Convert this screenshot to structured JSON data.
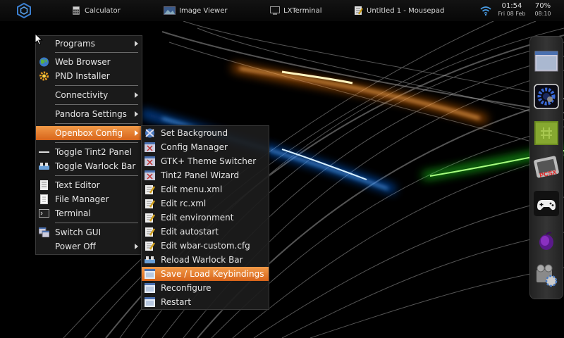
{
  "taskbar": {
    "tasks": [
      {
        "label": "Calculator",
        "icon": "calculator-icon"
      },
      {
        "label": "Image Viewer",
        "icon": "image-viewer-icon"
      },
      {
        "label": "LXTerminal",
        "icon": "terminal-icon"
      },
      {
        "label": "Untitled 1 - Mousepad",
        "icon": "text-editor-icon"
      }
    ],
    "clock_time": "01:54",
    "clock_date": "Fri 08 Feb",
    "battery_percent": "70%",
    "battery_time": "08:10"
  },
  "main_menu": {
    "items": [
      {
        "label": "Programs",
        "icon": "",
        "submenu": true
      },
      {
        "label": "Web Browser",
        "icon": "globe-icon",
        "submenu": false
      },
      {
        "label": "PND Installer",
        "icon": "gear-icon",
        "submenu": false
      },
      {
        "label": "Connectivity",
        "icon": "",
        "submenu": true
      },
      {
        "label": "Pandora Settings",
        "icon": "",
        "submenu": true
      },
      {
        "label": "Openbox Config",
        "icon": "",
        "submenu": true,
        "active": true
      },
      {
        "label": "Toggle Tint2 Panel",
        "icon": "panel-icon",
        "submenu": false
      },
      {
        "label": "Toggle Warlock Bar",
        "icon": "dock-bar-icon",
        "submenu": false
      },
      {
        "label": "Text Editor",
        "icon": "notepad-icon",
        "submenu": false
      },
      {
        "label": "File Manager",
        "icon": "file-manager-icon",
        "submenu": false
      },
      {
        "label": "Terminal",
        "icon": "terminal-icon",
        "submenu": false
      },
      {
        "label": "Switch GUI",
        "icon": "switch-gui-icon",
        "submenu": false
      },
      {
        "label": "Power Off",
        "icon": "",
        "submenu": true
      }
    ]
  },
  "sub_menu": {
    "items": [
      {
        "label": "Set Background",
        "icon": "background-icon"
      },
      {
        "label": "Config Manager",
        "icon": "config-icon"
      },
      {
        "label": "GTK+ Theme Switcher",
        "icon": "config-icon"
      },
      {
        "label": "Tint2 Panel Wizard",
        "icon": "config-icon"
      },
      {
        "label": "Edit menu.xml",
        "icon": "edit-file-icon"
      },
      {
        "label": "Edit rc.xml",
        "icon": "edit-file-icon"
      },
      {
        "label": "Edit environment",
        "icon": "edit-file-icon"
      },
      {
        "label": "Edit autostart",
        "icon": "edit-file-icon"
      },
      {
        "label": "Edit wbar-custom.cfg",
        "icon": "edit-file-icon"
      },
      {
        "label": "Reload Warlock Bar",
        "icon": "dock-bar-icon"
      },
      {
        "label": "Save / Load Keybindings",
        "icon": "window-icon",
        "active": true
      },
      {
        "label": "Reconfigure",
        "icon": "window-icon"
      },
      {
        "label": "Restart",
        "icon": "window-icon"
      }
    ]
  },
  "dock": {
    "items": [
      {
        "icon": "window-app-icon"
      },
      {
        "icon": "gear-cog-app-icon"
      },
      {
        "icon": "green-app-icon"
      },
      {
        "icon": "pcsx-emulator-icon"
      },
      {
        "icon": "gamepad-icon"
      },
      {
        "icon": "purple-orb-icon"
      },
      {
        "icon": "video-settings-icon"
      }
    ]
  },
  "colors": {
    "menu_highlight": "#e5782c",
    "wallpaper_orange": "#ff8a1e",
    "wallpaper_blue": "#1e8cff",
    "wallpaper_green": "#3cff2e"
  }
}
